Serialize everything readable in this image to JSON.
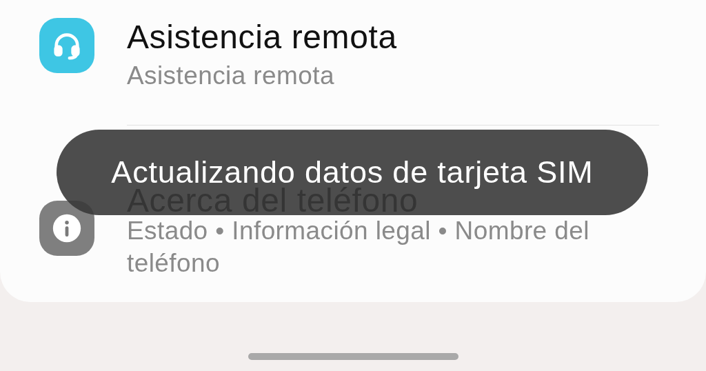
{
  "items": [
    {
      "kind": "support",
      "title": "Asistencia remota",
      "subtitle": "Asistencia remota"
    },
    {
      "kind": "info",
      "title": "Acerca del teléfono",
      "subtitle": "Estado • Información legal • Nombre del teléfono"
    }
  ],
  "toast": "Actualizando datos de tarjeta SIM"
}
